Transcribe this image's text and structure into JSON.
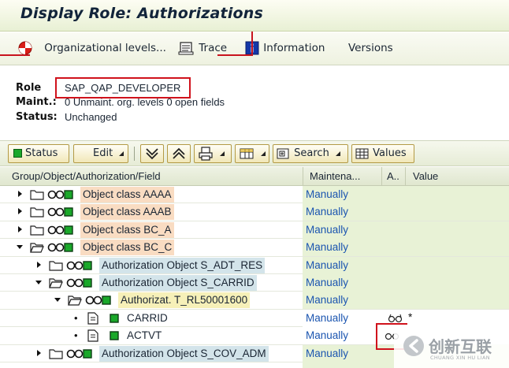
{
  "window": {
    "title": "Display Role: Authorizations"
  },
  "toolbar": {
    "org_levels": "Organizational levels...",
    "trace": "Trace",
    "information": "Information",
    "versions": "Versions"
  },
  "header": {
    "role_label": "Role",
    "role_value": "SAP_QAP_DEVELOPER",
    "maint_label": "Maint.:",
    "maint_value": "0 Unmaint. org. levels 0 open fields",
    "status_label": "Status:",
    "status_value": "Unchanged"
  },
  "tree_toolbar": {
    "status": "Status",
    "edit": "Edit",
    "search": "Search",
    "values": "Values"
  },
  "columns": {
    "tree": "Group/Object/Authorization/Field",
    "maintenance": "Maintena...",
    "a": "A..",
    "value": "Value"
  },
  "rows": [
    {
      "label": "Object class AAAA",
      "maint": "Manually",
      "value": ""
    },
    {
      "label": "Object class AAAB",
      "maint": "Manually",
      "value": ""
    },
    {
      "label": "Object class BC_A",
      "maint": "Manually",
      "value": ""
    },
    {
      "label": "Object class BC_C",
      "maint": "Manually",
      "value": ""
    },
    {
      "label": "Authorization Object S_ADT_RES",
      "maint": "Manually",
      "value": ""
    },
    {
      "label": "Authorization Object S_CARRID",
      "maint": "Manually",
      "value": ""
    },
    {
      "label": "Authorizat. T_RL50001600",
      "maint": "Manually",
      "value": ""
    },
    {
      "label": "CARRID",
      "maint": "Manually",
      "value": "*"
    },
    {
      "label": "ACTVT",
      "maint": "Manually",
      "value": ""
    },
    {
      "label": "Authorization Object S_COV_ADM",
      "maint": "Manually",
      "value": ""
    }
  ],
  "watermark": {
    "text": "创新互联",
    "sub": "CHUANG XIN HU LIAN"
  },
  "colors": {
    "class_bg": "#f9dcc2",
    "object_bg": "#d3e4ea",
    "auth_bg": "#f6f0b8",
    "field_bg": "#ffffff",
    "maint_bg": "#e8f2d6",
    "highlight": "#d0121c"
  }
}
